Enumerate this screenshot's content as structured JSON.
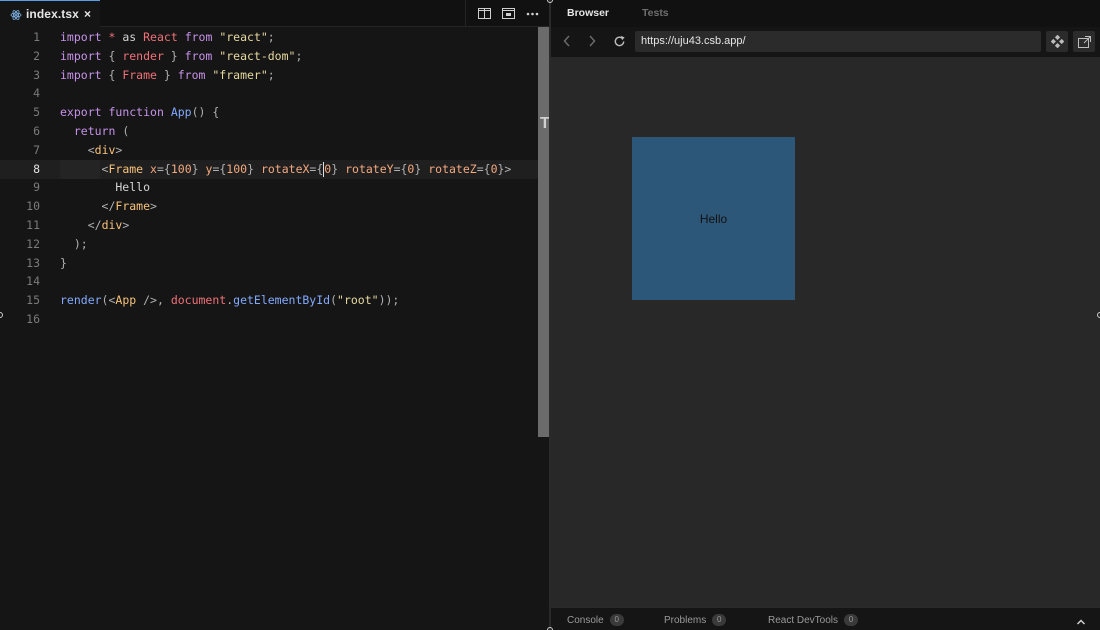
{
  "editor": {
    "tab": {
      "filename": "index.tsx",
      "close_glyph": "×",
      "icon": "react-icon"
    },
    "actions": [
      "split-view-icon",
      "preview-window-icon",
      "more-icon"
    ],
    "lines": [
      {
        "n": "1",
        "tokens": [
          [
            "k",
            "import"
          ],
          [
            "w",
            " "
          ],
          [
            "i",
            "*"
          ],
          [
            "w",
            " as "
          ],
          [
            "i",
            "React"
          ],
          [
            "w",
            " "
          ],
          [
            "k",
            "from"
          ],
          [
            "w",
            " "
          ],
          [
            "s",
            "\"react\""
          ],
          [
            "p",
            ";"
          ]
        ]
      },
      {
        "n": "2",
        "tokens": [
          [
            "k",
            "import"
          ],
          [
            "p",
            " { "
          ],
          [
            "i",
            "render"
          ],
          [
            "p",
            " } "
          ],
          [
            "k",
            "from"
          ],
          [
            "w",
            " "
          ],
          [
            "s",
            "\"react-dom\""
          ],
          [
            "p",
            ";"
          ]
        ]
      },
      {
        "n": "3",
        "tokens": [
          [
            "k",
            "import"
          ],
          [
            "p",
            " { "
          ],
          [
            "i",
            "Frame"
          ],
          [
            "p",
            " } "
          ],
          [
            "k",
            "from"
          ],
          [
            "w",
            " "
          ],
          [
            "s",
            "\"framer\""
          ],
          [
            "p",
            ";"
          ]
        ]
      },
      {
        "n": "4",
        "tokens": []
      },
      {
        "n": "5",
        "tokens": [
          [
            "k",
            "export"
          ],
          [
            "w",
            " "
          ],
          [
            "k",
            "function"
          ],
          [
            "w",
            " "
          ],
          [
            "f",
            "App"
          ],
          [
            "p",
            "() {"
          ]
        ]
      },
      {
        "n": "6",
        "tokens": [
          [
            "w",
            "  "
          ],
          [
            "k",
            "return"
          ],
          [
            "p",
            " ("
          ]
        ]
      },
      {
        "n": "7",
        "tokens": [
          [
            "w",
            "    "
          ],
          [
            "p",
            "<"
          ],
          [
            "t",
            "div"
          ],
          [
            "p",
            ">"
          ]
        ]
      },
      {
        "n": "8",
        "active": true,
        "tokens": [
          [
            "w",
            "      "
          ],
          [
            "p",
            "<"
          ],
          [
            "t",
            "Frame"
          ],
          [
            "w",
            " "
          ],
          [
            "a",
            "x"
          ],
          [
            "p",
            "={"
          ],
          [
            "a",
            "100"
          ],
          [
            "p",
            "}"
          ],
          [
            "w",
            " "
          ],
          [
            "a",
            "y"
          ],
          [
            "p",
            "={"
          ],
          [
            "a",
            "100"
          ],
          [
            "p",
            "}"
          ],
          [
            "w",
            " "
          ],
          [
            "a",
            "rotateX"
          ],
          [
            "p",
            "={"
          ],
          [
            "cursor",
            ""
          ],
          [
            "a",
            "0"
          ],
          [
            "p",
            "}"
          ],
          [
            "w",
            " "
          ],
          [
            "a",
            "rotateY"
          ],
          [
            "p",
            "={"
          ],
          [
            "a",
            "0"
          ],
          [
            "p",
            "}"
          ],
          [
            "w",
            " "
          ],
          [
            "a",
            "rotateZ"
          ],
          [
            "p",
            "={"
          ],
          [
            "a",
            "0"
          ],
          [
            "p",
            "}>"
          ]
        ]
      },
      {
        "n": "9",
        "tokens": [
          [
            "w",
            "        Hello"
          ]
        ]
      },
      {
        "n": "10",
        "tokens": [
          [
            "w",
            "      "
          ],
          [
            "p",
            "</"
          ],
          [
            "t",
            "Frame"
          ],
          [
            "p",
            ">"
          ]
        ]
      },
      {
        "n": "11",
        "tokens": [
          [
            "w",
            "    "
          ],
          [
            "p",
            "</"
          ],
          [
            "t",
            "div"
          ],
          [
            "p",
            ">"
          ]
        ]
      },
      {
        "n": "12",
        "tokens": [
          [
            "w",
            "  "
          ],
          [
            "p",
            ");"
          ]
        ]
      },
      {
        "n": "13",
        "tokens": [
          [
            "p",
            "}"
          ]
        ]
      },
      {
        "n": "14",
        "tokens": []
      },
      {
        "n": "15",
        "tokens": [
          [
            "f",
            "render"
          ],
          [
            "p",
            "(<"
          ],
          [
            "t",
            "App"
          ],
          [
            "p",
            " />, "
          ],
          [
            "i",
            "document"
          ],
          [
            "p",
            "."
          ],
          [
            "f",
            "getElementById"
          ],
          [
            "p",
            "("
          ],
          [
            "s",
            "\"root\""
          ],
          [
            "p",
            "));"
          ]
        ]
      },
      {
        "n": "16",
        "tokens": []
      }
    ],
    "scroll_marker": "T"
  },
  "preview": {
    "tabs": {
      "browser": "Browser",
      "tests": "Tests"
    },
    "url": "https://uju43.csb.app/",
    "frame_text": "Hello",
    "frame_color": "#2c5778",
    "bottom": {
      "console": "Console",
      "console_count": "0",
      "problems": "Problems",
      "problems_count": "0",
      "devtools": "React DevTools",
      "devtools_count": "0"
    }
  },
  "colors": {
    "accent": "#5a9ee6",
    "editor_bg": "#151515",
    "preview_bg": "#282828"
  }
}
